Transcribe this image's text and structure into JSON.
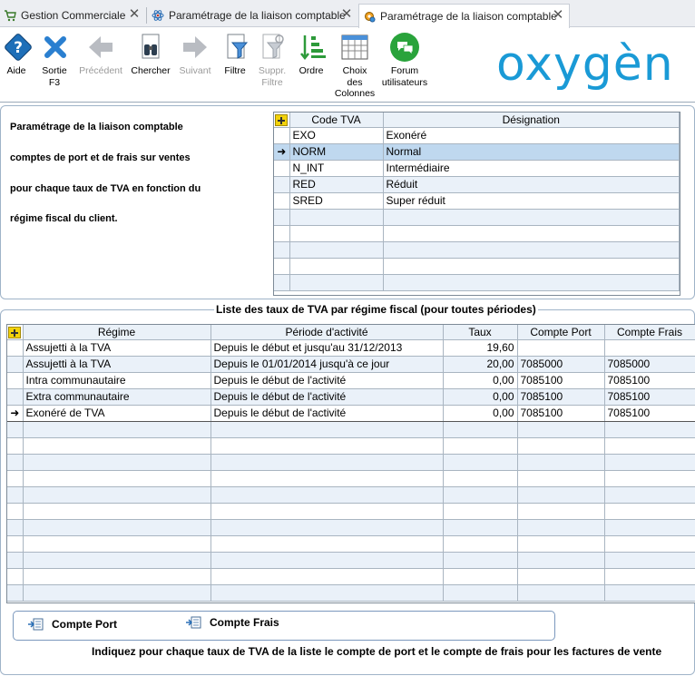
{
  "tabs": [
    {
      "label": "Gestion Commerciale",
      "icon": "cart-icon"
    },
    {
      "label": "Paramétrage de la liaison comptable",
      "icon": "atom-icon"
    },
    {
      "label": "Paramétrage de la liaison comptable",
      "icon": "gear-icon",
      "active": true
    }
  ],
  "toolbar": {
    "aide": "Aide",
    "sortie": "Sortie\nF3",
    "precedent": "Précédent",
    "chercher": "Chercher",
    "suivant": "Suivant",
    "filtre": "Filtre",
    "suppr_filtre": "Suppr.\nFiltre",
    "ordre": "Ordre",
    "choix_colonnes": "Choix\ndes\nColonnes",
    "forum": "Forum\nutilisateurs"
  },
  "logo": "oxygèn",
  "description": {
    "line1": "Paramétrage de la liaison comptable",
    "line2": "comptes de port et de frais sur ventes",
    "line3": "pour chaque taux de TVA en fonction du",
    "line4": "régime fiscal du client."
  },
  "tva_grid": {
    "headers": {
      "code": "Code TVA",
      "designation": "Désignation"
    },
    "rows": [
      {
        "code": "EXO",
        "designation": "Exonéré"
      },
      {
        "code": "NORM",
        "designation": "Normal"
      },
      {
        "code": "N_INT",
        "designation": "Intermédiaire"
      },
      {
        "code": "RED",
        "designation": "Réduit"
      },
      {
        "code": "SRED",
        "designation": "Super réduit"
      }
    ],
    "selected_index": 1
  },
  "regime_section_title": "Liste des taux de TVA par régime fiscal (pour toutes périodes)",
  "regime_grid": {
    "headers": {
      "regime": "Régime",
      "periode": "Période d'activité",
      "taux": "Taux",
      "compte_port": "Compte Port",
      "compte_frais": "Compte Frais"
    },
    "rows": [
      {
        "regime": "Assujetti à la TVA",
        "periode": "Depuis le début et jusqu'au 31/12/2013",
        "taux": "19,60",
        "compte_port": "",
        "compte_frais": ""
      },
      {
        "regime": "Assujetti à la TVA",
        "periode": "Depuis le 01/01/2014 jusqu'à ce jour",
        "taux": "20,00",
        "compte_port": "7085000",
        "compte_frais": "7085000"
      },
      {
        "regime": "Intra communautaire",
        "periode": "Depuis le début de l'activité",
        "taux": "0,00",
        "compte_port": "7085100",
        "compte_frais": "7085100"
      },
      {
        "regime": "Extra communautaire",
        "periode": "Depuis le début de l'activité",
        "taux": "0,00",
        "compte_port": "7085100",
        "compte_frais": "7085100"
      },
      {
        "regime": "Exonéré de TVA",
        "periode": "Depuis le début de l'activité",
        "taux": "0,00",
        "compte_port": "7085100",
        "compte_frais": "7085100"
      }
    ],
    "current_index": 4
  },
  "actions": {
    "compte_port": "Compte Port",
    "compte_frais": "Compte Frais"
  },
  "footer": "Indiquez pour chaque taux de TVA de la liste le compte de port et le compte de frais pour les factures de vente"
}
